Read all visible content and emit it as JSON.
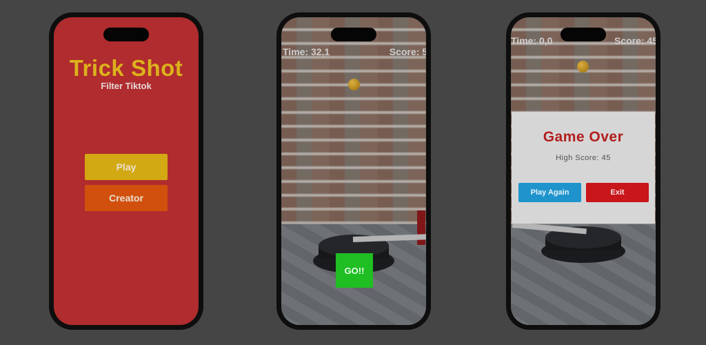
{
  "menu": {
    "title": "Trick Shot",
    "subtitle": "Filter Tiktok",
    "play_label": "Play",
    "creator_label": "Creator"
  },
  "game": {
    "time_text": "Time: 32,1",
    "score_text": "Score: 5",
    "go_label": "GO!!"
  },
  "gameover": {
    "time_text": "Time: 0,0",
    "score_text": "Score: 45",
    "title": "Game Over",
    "high_score_text": "High Score: 45",
    "play_again_label": "Play Again",
    "exit_label": "Exit"
  },
  "colors": {
    "menu_background": "#b02c2e",
    "title_yellow": "#dcb21c",
    "play_button": "#d3a913",
    "creator_button": "#d1500d",
    "go_button": "#1fbe23",
    "play_again_button": "#1f94cc",
    "exit_button": "#c8161a",
    "game_over_red": "#b31e1e"
  }
}
